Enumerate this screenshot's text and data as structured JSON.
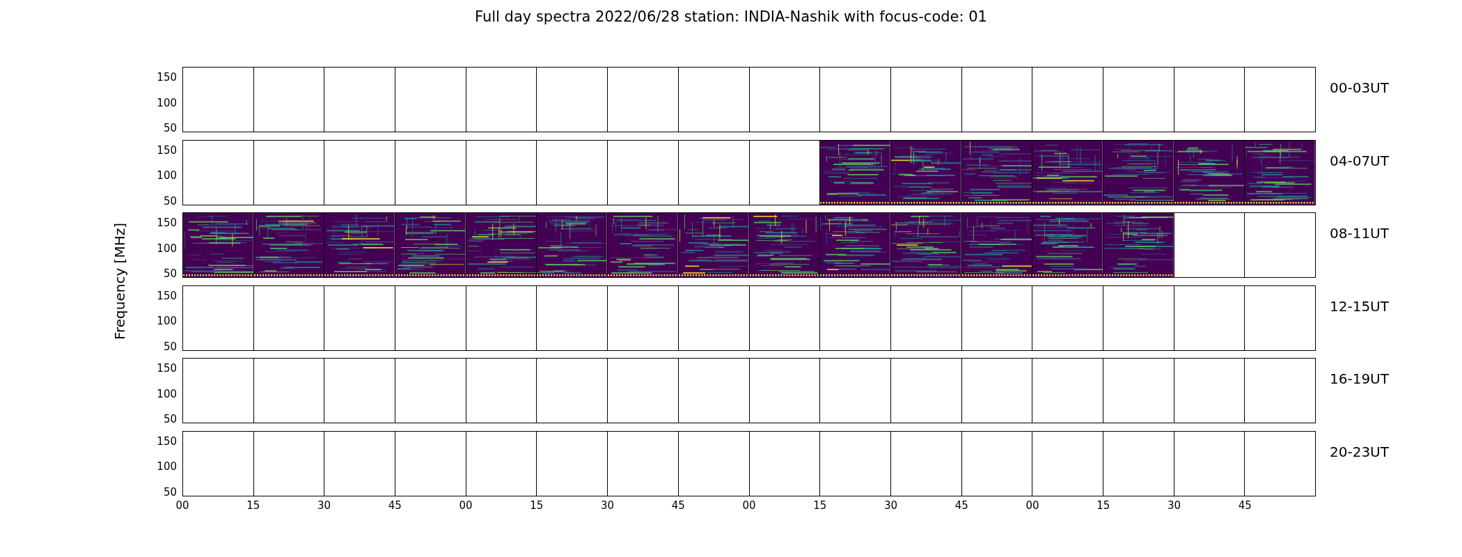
{
  "title": "Full day spectra 2022/06/28 station: INDIA-Nashik with focus-code: 01",
  "ylabel": "Frequency [MHz]",
  "x_ticks": [
    "00",
    "15",
    "30",
    "45",
    "00",
    "15",
    "30",
    "45",
    "00",
    "15",
    "30",
    "45",
    "00",
    "15",
    "30",
    "45"
  ],
  "rows": [
    {
      "label": "00-03UT",
      "y_ticks": [
        "150",
        "100",
        "50"
      ],
      "has_spectrum": [
        false,
        false,
        false,
        false,
        false,
        false,
        false,
        false,
        false,
        false,
        false,
        false,
        false,
        false,
        false,
        false
      ]
    },
    {
      "label": "04-07UT",
      "y_ticks": [
        "150",
        "100",
        "50"
      ],
      "has_spectrum": [
        false,
        false,
        false,
        false,
        false,
        false,
        false,
        false,
        false,
        true,
        true,
        true,
        true,
        true,
        true,
        true
      ]
    },
    {
      "label": "08-11UT",
      "y_ticks": [
        "150",
        "100",
        "50"
      ],
      "has_spectrum": [
        true,
        true,
        true,
        true,
        true,
        true,
        true,
        true,
        true,
        true,
        true,
        true,
        true,
        true,
        false,
        false
      ]
    },
    {
      "label": "12-15UT",
      "y_ticks": [
        "150",
        "100",
        "50"
      ],
      "has_spectrum": [
        false,
        false,
        false,
        false,
        false,
        false,
        false,
        false,
        false,
        false,
        false,
        false,
        false,
        false,
        false,
        false
      ]
    },
    {
      "label": "16-19UT",
      "y_ticks": [
        "150",
        "100",
        "50"
      ],
      "has_spectrum": [
        false,
        false,
        false,
        false,
        false,
        false,
        false,
        false,
        false,
        false,
        false,
        false,
        false,
        false,
        false,
        false
      ]
    },
    {
      "label": "20-23UT",
      "y_ticks": [
        "150",
        "100",
        "50"
      ],
      "has_spectrum": [
        false,
        false,
        false,
        false,
        false,
        false,
        false,
        false,
        false,
        false,
        false,
        false,
        false,
        false,
        false,
        false
      ]
    }
  ]
}
